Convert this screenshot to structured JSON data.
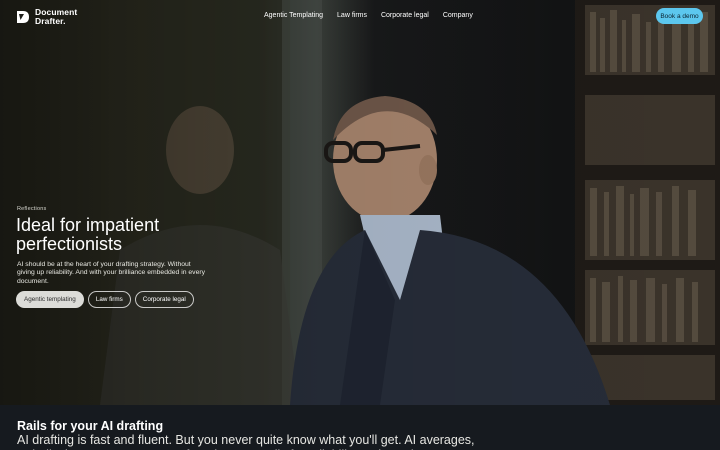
{
  "brand": {
    "name_line1": "Document",
    "name_line2": "Drafter."
  },
  "nav": {
    "items": [
      {
        "label": "Agentic Templating"
      },
      {
        "label": "Law firms"
      },
      {
        "label": "Corporate legal"
      },
      {
        "label": "Company"
      }
    ],
    "cta_label": "Book a demo"
  },
  "hero": {
    "eyebrow": "Reflections",
    "title": "Ideal for impatient perfectionists",
    "description": "AI should be at the heart of your drafting strategy. Without giving up reliability. And with your brilliance embedded in every document.",
    "pills": [
      {
        "label": "Agentic templating",
        "active": true
      },
      {
        "label": "Law firms",
        "active": false
      },
      {
        "label": "Corporate legal",
        "active": false
      }
    ]
  },
  "section": {
    "title": "Rails for your AI drafting",
    "body": "AI drafting is fast and fluent. But you never quite know what you'll get. AI averages, AI hallucinates. Document Drafter gives you rails for reliability and consistency."
  },
  "colors": {
    "accent": "#5cc7ee",
    "section_bg": "#161a1f",
    "active_pill": "#dcdcd8"
  }
}
